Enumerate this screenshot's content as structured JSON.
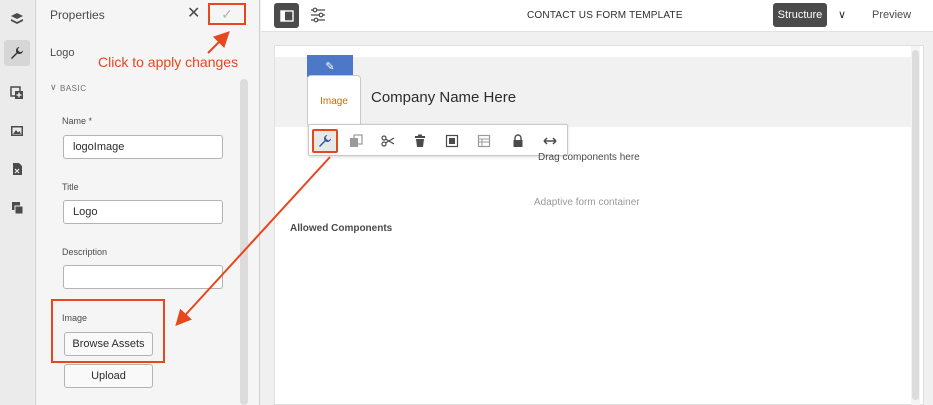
{
  "rail": {
    "icons": [
      "layers-icon",
      "wrench-icon",
      "add-panel-icon",
      "assets-icon",
      "document-icon",
      "stack-icon"
    ]
  },
  "panel": {
    "title": "Properties",
    "subtitle": "Logo",
    "hint": "Click to apply changes",
    "section": "BASIC",
    "fields": {
      "name_label": "Name *",
      "name_value": "logoImage",
      "title_label": "Title",
      "title_value": "Logo",
      "description_label": "Description",
      "description_value": "",
      "image_label": "Image",
      "browse_label": "Browse Assets",
      "upload_label": "Upload"
    },
    "colors": {
      "annotation": "#e8461e"
    }
  },
  "topbar": {
    "title": "CONTACT US FORM TEMPLATE",
    "mode": "Structure",
    "preview": "Preview"
  },
  "canvas": {
    "image_tile": "Image",
    "company": "Company Name Here",
    "drag_text": "Drag components here",
    "container_text": "Adaptive form container",
    "allowed_text": "Allowed Components",
    "toolbar_icons": [
      "wrench-icon",
      "copy-icon",
      "cut-icon",
      "delete-icon",
      "group-icon",
      "panel-icon",
      "lock-icon",
      "resize-icon"
    ],
    "accent_color": "#4d78c8",
    "image_label_color": "#c76c00"
  }
}
